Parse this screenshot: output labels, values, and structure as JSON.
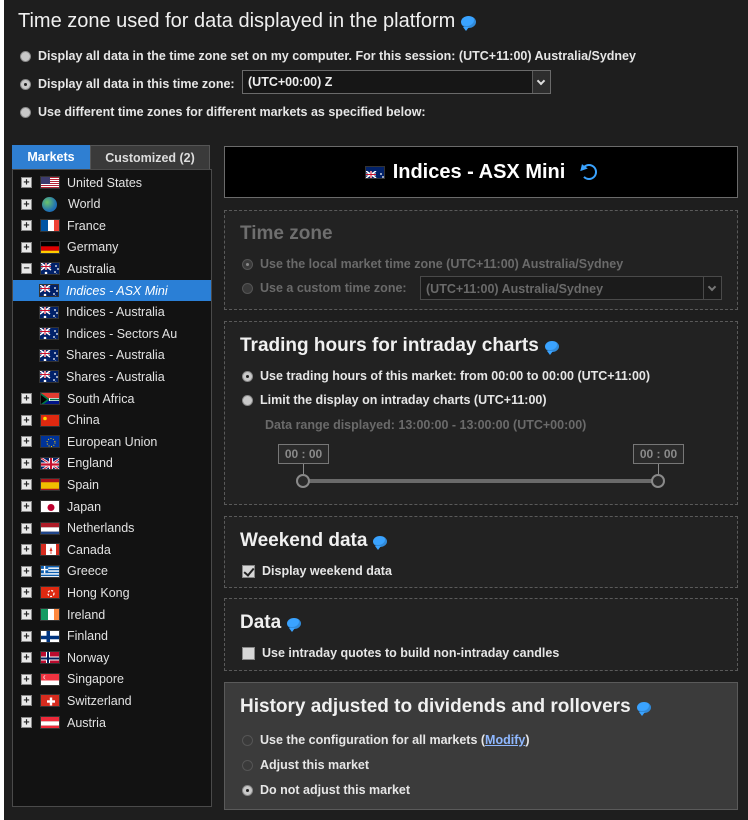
{
  "title": "Time zone used for data displayed in the platform",
  "timezone_options": {
    "computer": "Display all data in the time zone set on my computer. For this session: (UTC+11:00) Australia/Sydney",
    "this_zone": "Display all data in this time zone:",
    "different": "Use different time zones for different markets as specified below:",
    "selected_zone": "(UTC+00:00) Z"
  },
  "tabs": {
    "markets": "Markets",
    "customized": "Customized (2)"
  },
  "tree": [
    {
      "label": "United States",
      "flag": "us"
    },
    {
      "label": "World",
      "flag": "globe"
    },
    {
      "label": "France",
      "flag": "fr"
    },
    {
      "label": "Germany",
      "flag": "de"
    },
    {
      "label": "Australia",
      "flag": "au",
      "expanded": true
    },
    {
      "label": "Indices - ASX Mini",
      "flag": "au",
      "child": true,
      "selected": true
    },
    {
      "label": "Indices - Australia",
      "flag": "au",
      "child": true
    },
    {
      "label": "Indices - Sectors Au",
      "flag": "au",
      "child": true
    },
    {
      "label": "Shares - Australia",
      "flag": "au",
      "child": true
    },
    {
      "label": "Shares - Australia",
      "flag": "au",
      "child": true
    },
    {
      "label": "South Africa",
      "flag": "za"
    },
    {
      "label": "China",
      "flag": "cn"
    },
    {
      "label": "European Union",
      "flag": "eu"
    },
    {
      "label": "England",
      "flag": "gb"
    },
    {
      "label": "Spain",
      "flag": "es"
    },
    {
      "label": "Japan",
      "flag": "jp"
    },
    {
      "label": "Netherlands",
      "flag": "nl"
    },
    {
      "label": "Canada",
      "flag": "ca"
    },
    {
      "label": "Greece",
      "flag": "gr"
    },
    {
      "label": "Hong Kong",
      "flag": "hk"
    },
    {
      "label": "Ireland",
      "flag": "ie"
    },
    {
      "label": "Finland",
      "flag": "fi"
    },
    {
      "label": "Norway",
      "flag": "no"
    },
    {
      "label": "Singapore",
      "flag": "sg"
    },
    {
      "label": "Switzerland",
      "flag": "ch"
    },
    {
      "label": "Austria",
      "flag": "at"
    }
  ],
  "header": {
    "title": "Indices - ASX Mini"
  },
  "timezone_panel": {
    "title": "Time zone",
    "local": "Use the local market time zone (UTC+11:00) Australia/Sydney",
    "custom": "Use a custom time zone:",
    "custom_value": "(UTC+11:00) Australia/Sydney"
  },
  "trading_hours": {
    "title": "Trading hours for intraday charts",
    "use_market": "Use trading hours of this market: from 00:00 to 00:00 (UTC+11:00)",
    "limit": "Limit the display on intraday charts  (UTC+11:00)",
    "range": "Data range displayed: 13:00:00 - 13:00:00 (UTC+00:00)",
    "start": "00 : 00",
    "end": "00 : 00"
  },
  "weekend": {
    "title": "Weekend data",
    "option": "Display weekend data"
  },
  "data": {
    "title": "Data",
    "option": "Use intraday quotes to build non-intraday candles"
  },
  "history": {
    "title": "History adjusted to dividends and rollovers",
    "option_all": "Use the configuration for all markets (",
    "modify": "Modify",
    "close_paren": ")",
    "adjust": "Adjust this market",
    "no_adjust": "Do not adjust this market"
  },
  "colors": {
    "accent": "#2a7fd6",
    "bubble": "#3aa3ff",
    "background": "#1e1e1e"
  }
}
